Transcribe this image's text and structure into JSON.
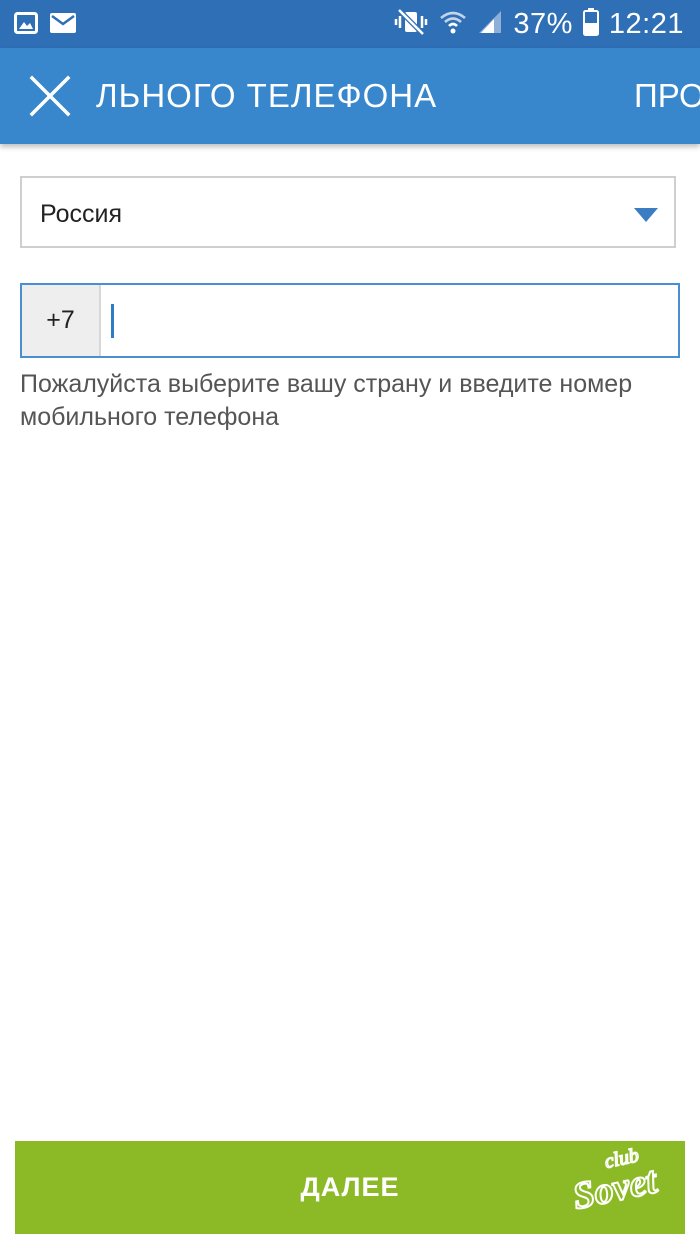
{
  "status_bar": {
    "battery": "37%",
    "time": "12:21",
    "icons": [
      "gallery-icon",
      "mail-icon",
      "mute-vibrate-icon",
      "wifi-icon",
      "signal-icon",
      "battery-icon"
    ]
  },
  "app_bar": {
    "title": "ЛЬНОГО ТЕЛЕФОНА",
    "action_label": "ПРО",
    "close_icon": "close-icon"
  },
  "form": {
    "country": "Россия",
    "phone_prefix": "+7",
    "phone_value": "",
    "hint": "Пожалуйста выберите вашу страну и введите номер мобильного телефона"
  },
  "next_button": {
    "label": "ДАЛЕЕ"
  },
  "watermark": {
    "line1": "club",
    "line2": "Sovet"
  },
  "colors": {
    "status_bar": "#2f6fb6",
    "app_bar": "#3886cc",
    "accent": "#4a8fd1",
    "button": "#8bba26"
  }
}
